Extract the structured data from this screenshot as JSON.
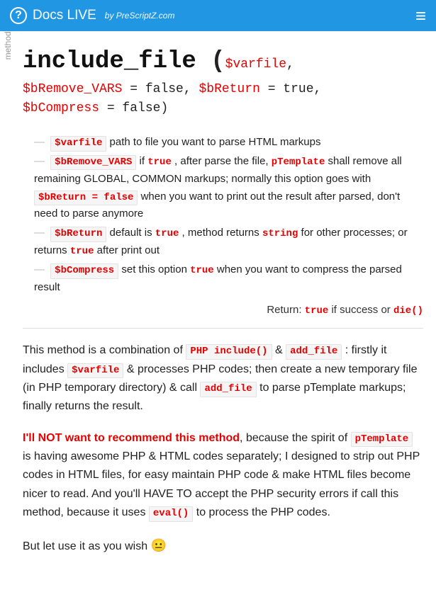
{
  "header": {
    "title": "Docs LIVE",
    "byline": "by PreScriptZ.com",
    "help_glyph": "?",
    "menu_glyph": "≡"
  },
  "sidelabel": "method",
  "signature": {
    "name": "include_file",
    "open": " (",
    "p1": "$varfile",
    "sep1": ",",
    "p2": "$bRemove_VARS",
    "p2def": " = false, ",
    "p3": "$bReturn",
    "p3def": " = true,",
    "p4": "$bCompress",
    "p4def": " = false)"
  },
  "params": {
    "p1": {
      "code": "$varfile",
      "text": " path to file you want to parse HTML markups"
    },
    "p2": {
      "code": "$bRemove_VARS",
      "t1": " if ",
      "c1": "true",
      "t2": " , after parse the file, ",
      "c2": "pTemplate",
      "t3": " shall remove all remaining GLOBAL, COMMON markups; normally this option goes with ",
      "c3": "$bReturn = false",
      "t4": " when you want to print out the result after parsed, don't need to parse anymore"
    },
    "p3": {
      "code": "$bReturn",
      "t1": " default is ",
      "c1": "true",
      "t2": " , method returns ",
      "c2": "string",
      "t3": " for other processes; or returns ",
      "c3": "true",
      "t4": " after print out"
    },
    "p4": {
      "code": "$bCompress",
      "t1": " set this option ",
      "c1": "true",
      "t2": " when you want to compress the parsed result"
    },
    "ret": {
      "label": "Return: ",
      "c1": "true",
      "t1": " if success or ",
      "c2": "die()"
    }
  },
  "body": {
    "para1": {
      "t1": "This method is a combination of ",
      "c1": "PHP include()",
      "t2": " & ",
      "c2": "add_file",
      "t3": " : firstly it includes ",
      "c3": "$varfile",
      "t4": " & processes PHP codes; then create a new temporary file (in PHP temporary directory) & call ",
      "c4": "add_file",
      "t5": " to parse pTemplate markups; finally returns the result."
    },
    "para2": {
      "warn": "I'll NOT want to recommend this method",
      "t1": ", because the spirit of ",
      "c1": "pTemplate",
      "t2": " is having awesome PHP & HTML codes separately; I designed to strip out PHP codes in HTML files, for easy maintain PHP code & make HTML files become nicer to read. And you'll HAVE TO accept the PHP security errors if call this method, because it uses ",
      "c2": "eval()",
      "t3": " to process the PHP codes."
    },
    "para3": {
      "t1": "But let use it as you wish ",
      "emoji": "😐"
    }
  }
}
